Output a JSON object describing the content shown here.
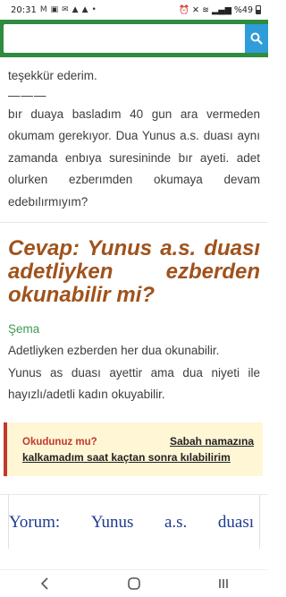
{
  "status_bar": {
    "time": "20:31",
    "icons_left": [
      "m-icon",
      "gallery-icon",
      "mail-icon",
      "bell-icon",
      "bell-icon",
      "dot-icon"
    ],
    "signal_text": "%49"
  },
  "search": {
    "placeholder": "",
    "value": ""
  },
  "article": {
    "intro_text": "teşekkür ederim.",
    "divider": "———",
    "question_text": "bır duaya basladım 40 gun ara vermeden okumam gerekıyor. Dua Yunus a.s. duası aynı zamanda enbıya suresininde bır ayeti. adet olurken ezberımden okumaya devam edebılırmıyım?",
    "answer_heading": "Cevap: Yunus a.s. duası adetliyken ezberden okunabilir mi?",
    "author": "Şema",
    "answer_line_1": "Adetliyken ezberden her dua okunabilir.",
    "answer_line_2": "Yunus as duası ayettir ama dua niyeti ile hayızlı/adetli kadın okuyabilir.",
    "read_box": {
      "label": "Okudunuz mu?",
      "link_part_1": "Sabah namazına",
      "link_part_2": "kalkamadım saat kaçtan sonra kılabilirim"
    },
    "comment_heading": [
      "Yorum:",
      "Yunus",
      "a.s.",
      "duası"
    ]
  },
  "nav": {
    "back": "‹",
    "home": "○",
    "recents": "|||"
  },
  "colors": {
    "header_green": "#2e8b3f",
    "search_blue": "#2f9dd9",
    "answer_brown": "#a0521c",
    "author_green": "#3f9b55",
    "read_red": "#c0392b",
    "comment_blue": "#1f3b8f"
  }
}
